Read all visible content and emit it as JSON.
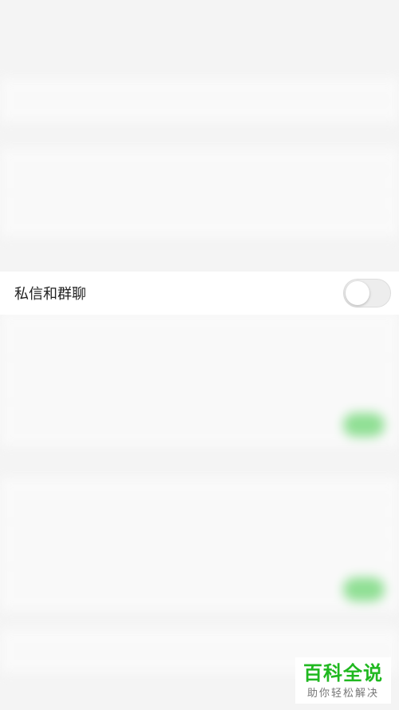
{
  "status_bar": {
    "carrier": "",
    "time": "",
    "battery": ""
  },
  "nav": {
    "back_label": "",
    "title": ""
  },
  "focused_setting": {
    "label": "私信和群聊",
    "enabled": false
  },
  "watermark": {
    "title": "百科全说",
    "subtitle": "助你轻松解决"
  },
  "colors": {
    "toggle_on": "#4cd964",
    "watermark_green": "#20b820"
  }
}
